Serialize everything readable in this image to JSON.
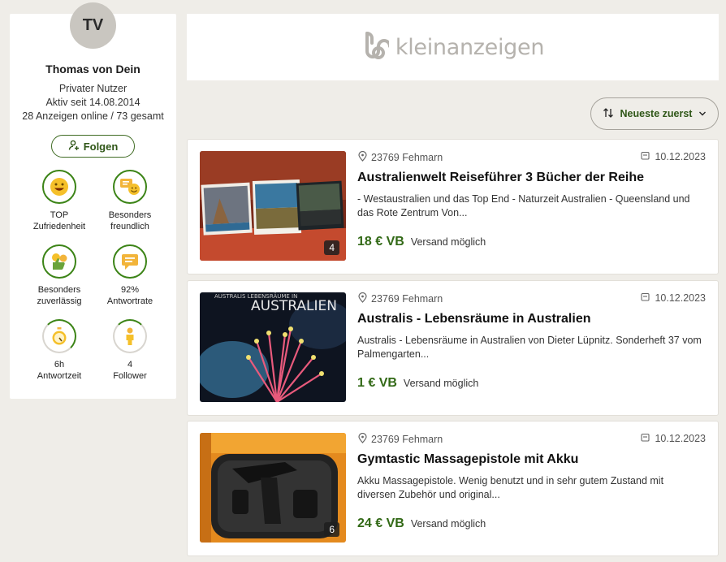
{
  "profile": {
    "initials": "TV",
    "name": "Thomas von Dein",
    "type": "Privater Nutzer",
    "active_since": "Aktiv seit 14.08.2014",
    "ads_count": "28 Anzeigen online / 73 gesamt",
    "follow_label": "Folgen",
    "badges": [
      {
        "line1": "TOP",
        "line2": "Zufriedenheit",
        "icon": "smiley-icon"
      },
      {
        "line1": "Besonders",
        "line2": "freundlich",
        "icon": "chat-smiley-icon"
      },
      {
        "line1": "Besonders",
        "line2": "zuverlässig",
        "icon": "thumbs-up-icon"
      },
      {
        "line1": "92%",
        "line2": "Antwortrate",
        "icon": "message-icon"
      },
      {
        "line1": "6h",
        "line2": "Antwortzeit",
        "icon": "stopwatch-icon"
      },
      {
        "line1": "4",
        "line2": "Follower",
        "icon": "person-icon"
      }
    ]
  },
  "brand": {
    "name": "kleinanzeigen"
  },
  "sort": {
    "label": "Neueste zuerst"
  },
  "listings": [
    {
      "location": "23769 Fehmarn",
      "date": "10.12.2023",
      "title": "Australienwelt Reiseführer 3 Bücher der Reihe",
      "description": "- Westaustralien und das Top End - Naturzeit Australien - Queensland und das Rote Zentrum Von...",
      "price": "18 € VB",
      "shipping": "Versand möglich",
      "image_count": "4"
    },
    {
      "location": "23769 Fehmarn",
      "date": "10.12.2023",
      "title": "Australis - Lebensräume in Australien",
      "description": "Australis - Lebensräume in Australien von Dieter Lüpnitz. Sonderheft 37 vom Palmengarten...",
      "price": "1 € VB",
      "shipping": "Versand möglich",
      "image_count": "",
      "cover_title": "AUSTRALIEN",
      "cover_subtitle": "AUSTRALIS LEBENSRÄUME IN"
    },
    {
      "location": "23769 Fehmarn",
      "date": "10.12.2023",
      "title": "Gymtastic Massagepistole mit Akku",
      "description": "Akku Massagepistole. Wenig benutzt und in sehr gutem Zustand mit diversen Zubehör und original...",
      "price": "24 € VB",
      "shipping": "Versand möglich",
      "image_count": "6"
    }
  ],
  "colors": {
    "accent": "#326916",
    "background": "#efede8"
  }
}
